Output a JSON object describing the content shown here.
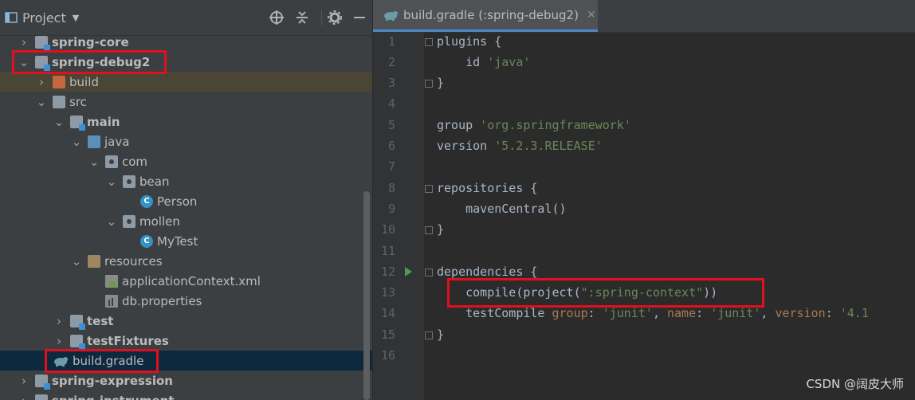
{
  "panel": {
    "title": "Project",
    "icons": [
      "project-panel-icon",
      "locate-icon",
      "collapse-all-icon",
      "gear-icon",
      "hide-icon"
    ]
  },
  "tree": [
    {
      "label": "spring-core",
      "bold": true
    },
    {
      "label": "spring-debug2",
      "bold": true
    },
    {
      "label": "build",
      "bold": false
    },
    {
      "label": "src",
      "bold": false
    },
    {
      "label": "main",
      "bold": true
    },
    {
      "label": "java",
      "bold": false
    },
    {
      "label": "com",
      "bold": false
    },
    {
      "label": "bean",
      "bold": false
    },
    {
      "label": "Person",
      "bold": false
    },
    {
      "label": "mollen",
      "bold": false
    },
    {
      "label": "MyTest",
      "bold": false
    },
    {
      "label": "resources",
      "bold": false
    },
    {
      "label": "applicationContext.xml",
      "bold": false
    },
    {
      "label": "db.properties",
      "bold": false
    },
    {
      "label": "test",
      "bold": true
    },
    {
      "label": "testFixtures",
      "bold": true
    },
    {
      "label": "build.gradle",
      "bold": false
    },
    {
      "label": "spring-expression",
      "bold": true
    },
    {
      "label": "spring-instrument",
      "bold": true
    }
  ],
  "editor": {
    "tab_label": "build.gradle (:spring-debug2)",
    "line_numbers": [
      "1",
      "2",
      "3",
      "4",
      "5",
      "6",
      "7",
      "8",
      "9",
      "10",
      "11",
      "12",
      "13",
      "14",
      "15",
      "16"
    ],
    "lines": [
      {
        "plain": "plugins {"
      },
      {
        "plain": "    id ",
        "str": "'java'"
      },
      {
        "plain": "}"
      },
      {
        "plain": ""
      },
      {
        "plain": "group ",
        "str": "'org.springframework'"
      },
      {
        "plain": "version ",
        "str": "'5.2.3.RELEASE'"
      },
      {
        "plain": ""
      },
      {
        "plain": "repositories {"
      },
      {
        "plain": "    mavenCentral()"
      },
      {
        "plain": "}"
      },
      {
        "plain": ""
      },
      {
        "plain": "dependencies {"
      },
      {
        "plain": "    compile(project(",
        "str": "\":spring-context\"",
        "tail": "))"
      },
      {
        "plain": "    testCompile ",
        "named1": "group",
        "p2": ": ",
        "s1": "'junit'",
        "p3": ", ",
        "named2": "name",
        "p4": ": ",
        "s2": "'junit'",
        "p5": ", ",
        "named3": "version",
        "p6": ": ",
        "s3": "'4.1"
      },
      {
        "plain": "}"
      },
      {
        "plain": ""
      }
    ]
  },
  "watermark": "CSDN @阔皮大师"
}
